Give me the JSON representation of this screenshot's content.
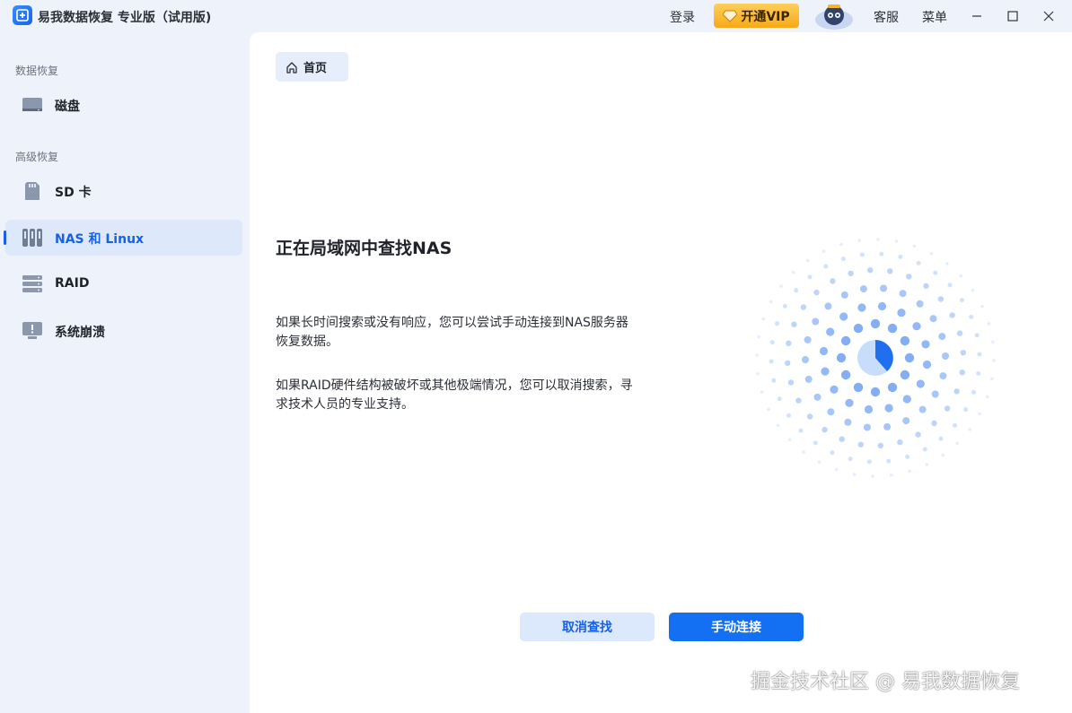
{
  "app": {
    "title": "易我数据恢复 专业版（试用版)"
  },
  "titlebar": {
    "login": "登录",
    "vip": "开通VIP",
    "support": "客服",
    "menu": "菜单"
  },
  "sidebar": {
    "section_recovery": "数据恢复",
    "section_advanced": "高级恢复",
    "items": [
      {
        "label": "磁盘",
        "icon": "disk-icon"
      },
      {
        "label": "SD 卡",
        "icon": "sd-card-icon"
      },
      {
        "label": "NAS 和 Linux",
        "icon": "nas-icon",
        "active": true
      },
      {
        "label": "RAID",
        "icon": "raid-icon"
      },
      {
        "label": "系统崩溃",
        "icon": "system-crash-icon"
      }
    ]
  },
  "main": {
    "breadcrumb": "首页",
    "heading": "正在局域网中查找NAS",
    "para1_line1": "如果长时间搜索或没有响应，您可以尝试手动连接到NAS服务器",
    "para1_line2": "恢复数据。",
    "para2_line1": "如果RAID硬件结构被破坏或其他极端情况，您可以取消搜索，寻",
    "para2_line2": "求技术人员的专业支持。",
    "cancel_button": "取消查找",
    "connect_button": "手动连接"
  },
  "colors": {
    "accent": "#1470f3",
    "active_bg": "#dde8fb",
    "vip": "#f6a917"
  },
  "watermark": "掘金技术社区 @ 易我数据恢复"
}
